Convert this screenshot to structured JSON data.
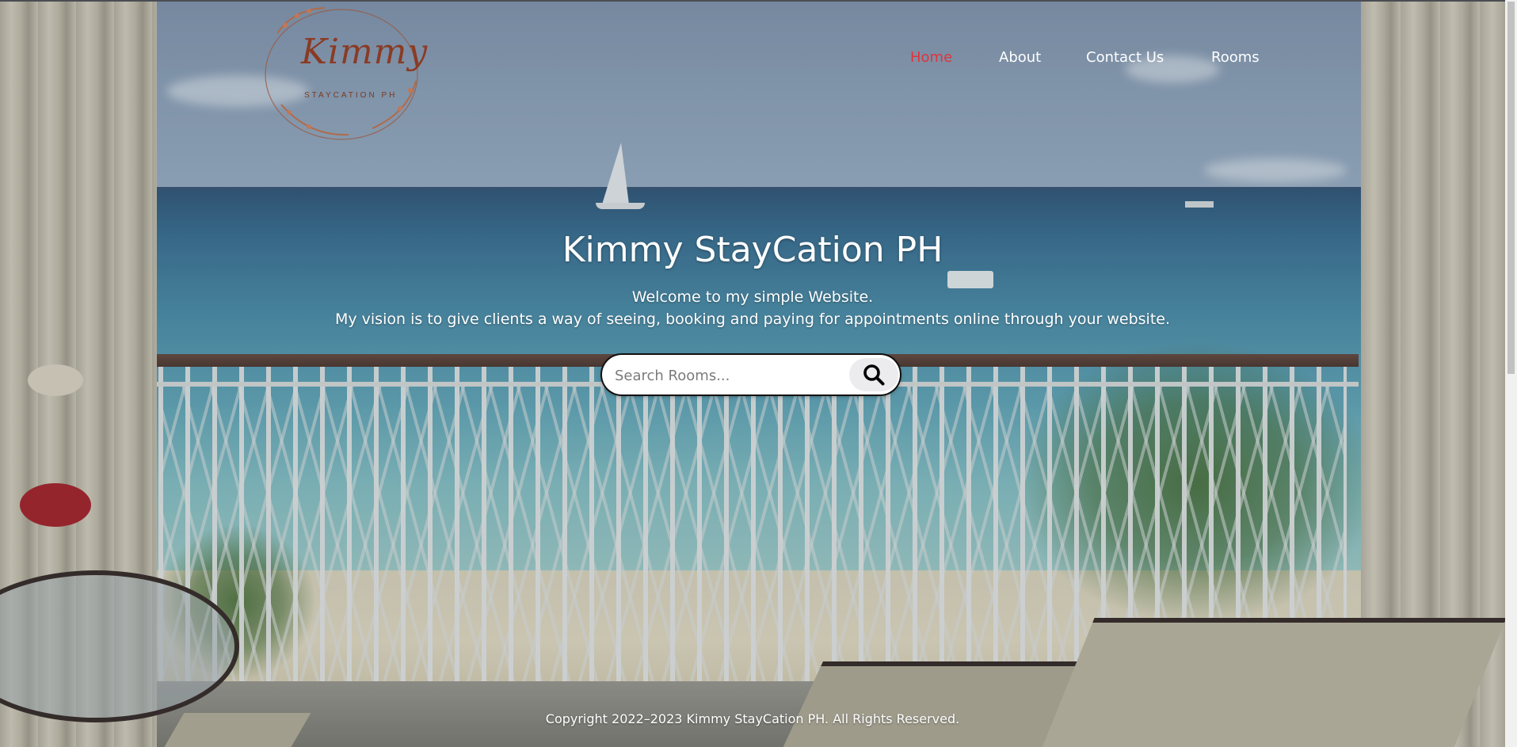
{
  "brand": {
    "logo_text": "Kimmy",
    "logo_subtext": "STAYCATION PH"
  },
  "nav": {
    "items": [
      {
        "label": "Home",
        "active": true
      },
      {
        "label": "About",
        "active": false
      },
      {
        "label": "Contact Us",
        "active": false
      },
      {
        "label": "Rooms",
        "active": false
      }
    ]
  },
  "hero": {
    "title": "Kimmy StayCation PH",
    "line1": "Welcome to my simple Website.",
    "line2": "My vision is to give clients a way of seeing, booking and paying for appointments online through your website."
  },
  "search": {
    "placeholder": "Search Rooms...",
    "button_icon": "search-icon"
  },
  "footer": {
    "copyright": "Copyright 2022–2023 Kimmy StayCation PH. All Rights Reserved."
  },
  "colors": {
    "nav_active": "#e0343c",
    "nav_text": "#ffffff",
    "logo": "#8a3b24"
  }
}
